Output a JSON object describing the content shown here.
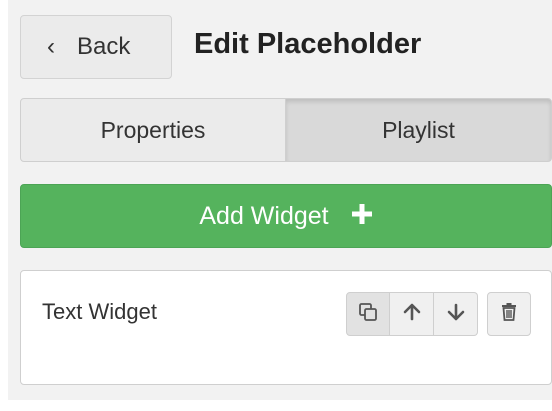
{
  "header": {
    "back_label": "Back",
    "back_icon": "chevron-left-icon",
    "title": "Edit Placeholder"
  },
  "tabs": [
    {
      "label": "Properties",
      "active": false
    },
    {
      "label": "Playlist",
      "active": true
    }
  ],
  "add_widget": {
    "label": "Add Widget",
    "icon": "plus-icon",
    "color": "#55b35d"
  },
  "widgets": [
    {
      "name": "Text Widget",
      "actions": [
        "copy-icon",
        "arrow-up-icon",
        "arrow-down-icon",
        "trash-icon"
      ]
    }
  ]
}
